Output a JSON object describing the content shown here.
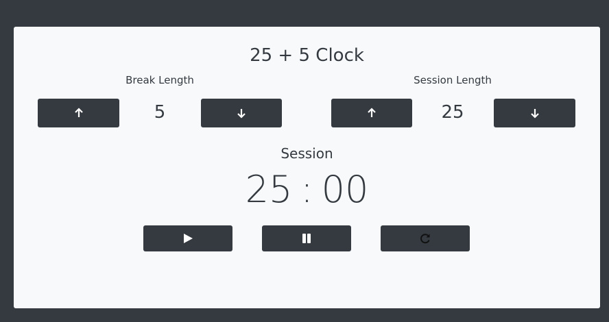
{
  "title": "25 + 5 Clock",
  "break": {
    "label": "Break Length",
    "value": "5",
    "increment_icon": "arrow-up-icon",
    "decrement_icon": "arrow-down-icon"
  },
  "session": {
    "label": "Session Length",
    "value": "25",
    "increment_icon": "arrow-up-icon",
    "decrement_icon": "arrow-down-icon"
  },
  "timer": {
    "label": "Session",
    "minutes": "25",
    "separator": ":",
    "seconds": "00"
  },
  "controls": {
    "play_icon": "play-icon",
    "pause_icon": "pause-icon",
    "reset_icon": "reset-icon"
  },
  "colors": {
    "background": "#343a40",
    "card": "#f7f9fb",
    "button": "#343a40",
    "text": "#343a40"
  }
}
